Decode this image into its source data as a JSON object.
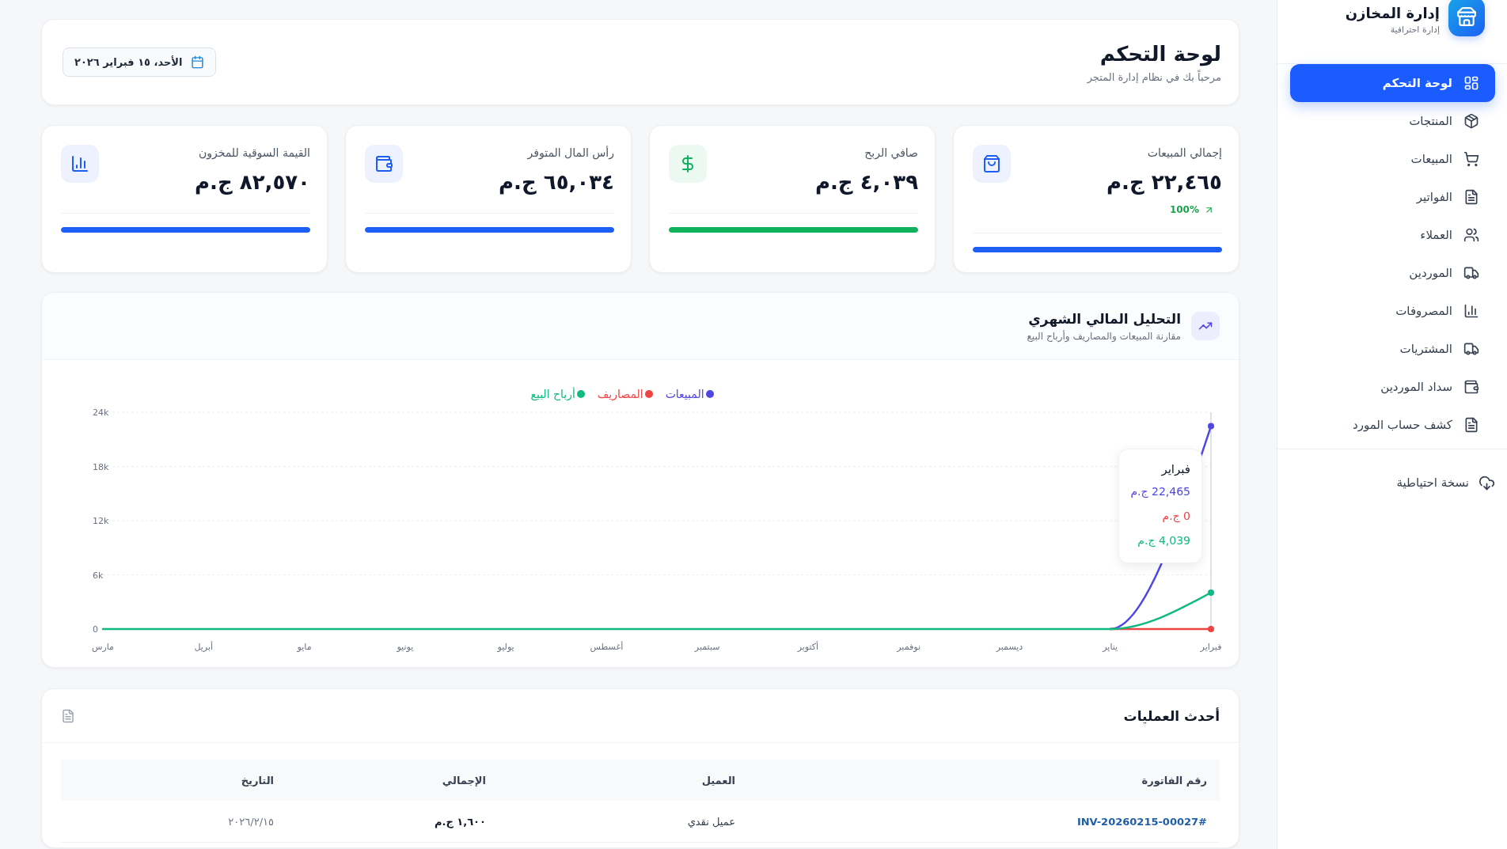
{
  "sidebar": {
    "brand": {
      "title": "إدارة المخازن",
      "subtitle": "إدارة احترافية"
    },
    "items": [
      {
        "label": "لوحة التحكم",
        "selected": true
      },
      {
        "label": "المنتجات",
        "selected": false
      },
      {
        "label": "المبيعات",
        "selected": false
      },
      {
        "label": "الفواتير",
        "selected": false
      },
      {
        "label": "العملاء",
        "selected": false
      },
      {
        "label": "الموردين",
        "selected": false
      },
      {
        "label": "المصروفات",
        "selected": false
      },
      {
        "label": "المشتريات",
        "selected": false
      },
      {
        "label": "سداد الموردين",
        "selected": false
      },
      {
        "label": "كشف حساب المورد",
        "selected": false
      }
    ],
    "footer_items": [
      {
        "label": "نسخة احتياطية"
      }
    ]
  },
  "header": {
    "title": "لوحة التحكم",
    "subtitle": "مرحباً بك في نظام إدارة المتجر",
    "date": "الأحد، ١٥ فبراير ٢٠٢٦"
  },
  "stats": [
    {
      "label": "إجمالي المبيعات",
      "value": "٢٢,٤٦٥ ج.م",
      "change": "100%",
      "color": "#1d5ff5",
      "level": 1
    },
    {
      "label": "صافي الربح",
      "value": "٤,٠٣٩ ج.م",
      "color": "#10b15c",
      "level": 1
    },
    {
      "label": "رأس المال المتوفر",
      "value": "٦٥,٠٣٤ ج.م",
      "color": "#1d5ff5",
      "level": 1
    },
    {
      "label": "القيمة السوقية للمخزون",
      "value": "٨٢,٥٧٠ ج.م",
      "color": "#1d5ff5",
      "level": 1
    }
  ],
  "chart_card": {
    "title": "التحليل المالي الشهري",
    "subtitle": "مقارنة المبيعات والمصاريف وأرباح البيع",
    "chart_data": {
      "type": "line",
      "categories": [
        "مارس",
        "أبريل",
        "مايو",
        "يونيو",
        "يوليو",
        "أغسطس",
        "سبتمبر",
        "أكتوبر",
        "نوفمبر",
        "ديسمبر",
        "يناير",
        "فبراير"
      ],
      "series": [
        {
          "name": "المبيعات",
          "color": "#5046e5",
          "values": [
            null,
            null,
            null,
            null,
            null,
            null,
            null,
            null,
            null,
            null,
            0,
            22465
          ]
        },
        {
          "name": "المصاريف",
          "color": "#ef4444",
          "values": [
            null,
            null,
            null,
            null,
            null,
            null,
            null,
            null,
            null,
            null,
            0,
            0
          ]
        },
        {
          "name": "أرباح البيع",
          "color": "#10b981",
          "values": [
            0,
            0,
            0,
            0,
            0,
            0,
            0,
            0,
            0,
            0,
            0,
            4039
          ]
        }
      ],
      "ylim": [
        0,
        24000
      ],
      "yticks": [
        {
          "value": 0,
          "label": "0"
        },
        {
          "value": 6000,
          "label": "6k"
        },
        {
          "value": 12000,
          "label": "12k"
        },
        {
          "value": 18000,
          "label": "18k"
        },
        {
          "value": 24000,
          "label": "24k"
        }
      ],
      "grid": true,
      "legend": "top"
    },
    "tooltip": {
      "title": "فبراير",
      "values": [
        "22,465 ج.م",
        "0 ج.م",
        "4,039 ج.م"
      ]
    }
  },
  "recent": {
    "title": "أحدث العمليات",
    "columns": [
      "رقم الفاتورة",
      "العميل",
      "الإجمالي",
      "التاريخ"
    ],
    "rows": [
      [
        "#INV-20260215-00027",
        "عميل نقدي",
        "١,٦٠٠ ج.م",
        "٢٠٢٦/٢/١٥"
      ]
    ]
  }
}
